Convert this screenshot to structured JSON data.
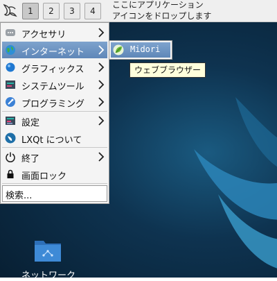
{
  "panel": {
    "desktops": [
      "1",
      "2",
      "3",
      "4"
    ],
    "active_desktop": 1,
    "drop_hint_line1": "ここにアプリケーション",
    "drop_hint_line2": "アイコンをドロップします"
  },
  "menu": {
    "items": [
      {
        "label": "アクセサリ",
        "icon": "accessories-icon",
        "submenu": true
      },
      {
        "label": "インターネット",
        "icon": "internet-globe-icon",
        "submenu": true,
        "highlighted": true
      },
      {
        "label": "グラフィックス",
        "icon": "graphics-icon",
        "submenu": true
      },
      {
        "label": "システムツール",
        "icon": "system-tools-icon",
        "submenu": true
      },
      {
        "label": "プログラミング",
        "icon": "programming-icon",
        "submenu": true
      },
      {
        "label": "設定",
        "icon": "settings-icon",
        "submenu": true
      },
      {
        "label": "LXQt について",
        "icon": "lxqt-logo-icon",
        "submenu": false
      },
      {
        "label": "終了",
        "icon": "power-icon",
        "submenu": true
      },
      {
        "label": "画面ロック",
        "icon": "lock-icon",
        "submenu": false
      }
    ],
    "search_label": "検索..."
  },
  "submenu": {
    "item_label": "Midori",
    "item_icon": "midori-leaf-icon"
  },
  "tooltip": "ウェブブラウザー",
  "desktop_icon": {
    "label": "ネットワーク",
    "icon": "network-folder-icon"
  },
  "colors": {
    "highlight": "#6f95c4",
    "desktop_bg": "#0e3350",
    "tooltip_bg": "#ffffdc"
  }
}
